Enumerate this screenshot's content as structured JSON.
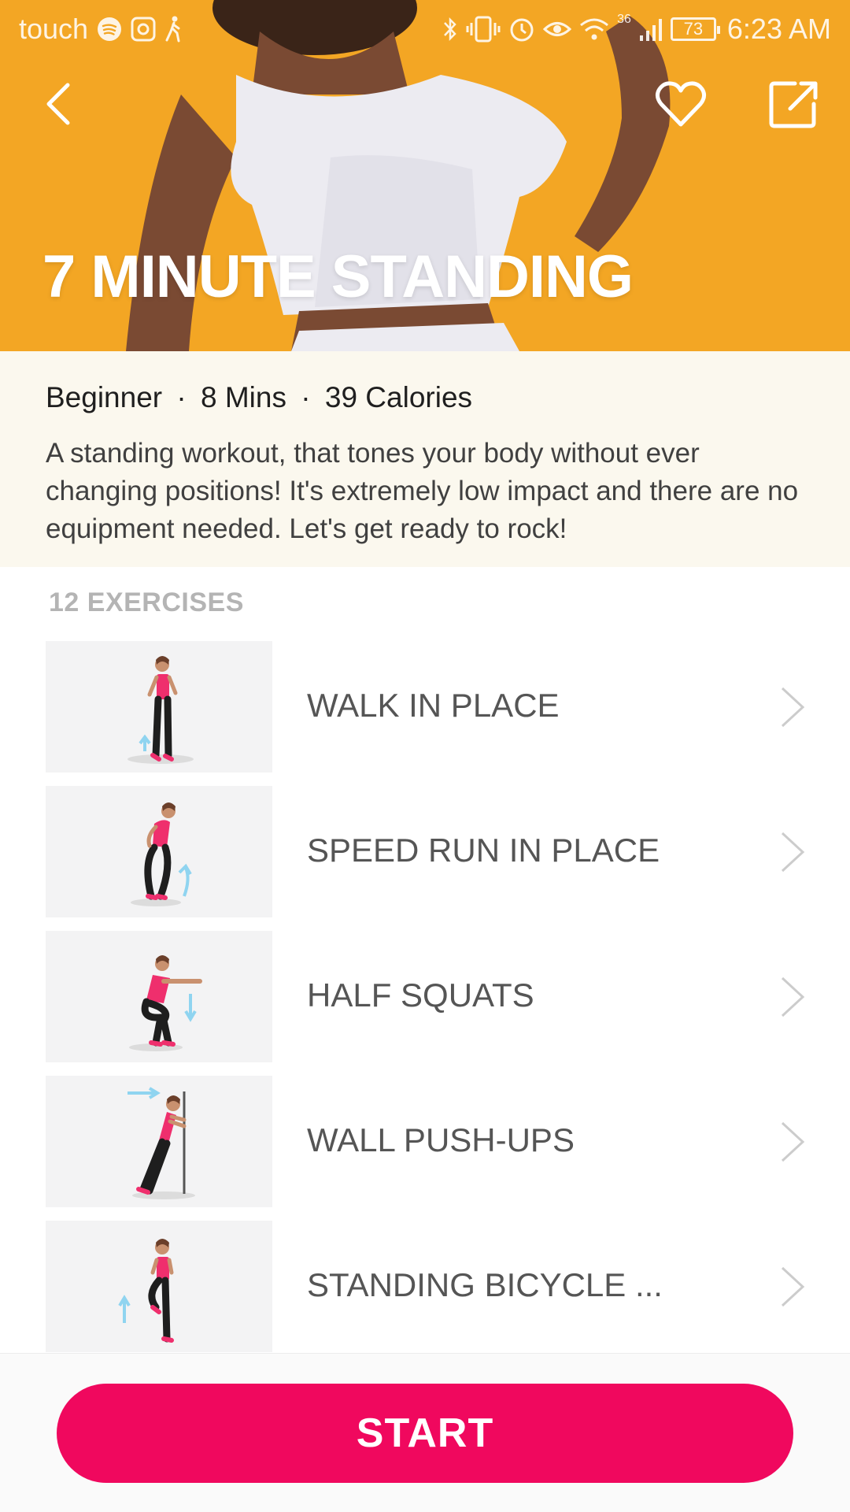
{
  "status_bar": {
    "carrier": "touch",
    "left_icons": [
      "spotify-icon",
      "instagram-icon",
      "walking-icon"
    ],
    "right_icons": [
      "bluetooth-icon",
      "vibrate-icon",
      "alarm-icon",
      "eye-icon",
      "wifi-icon",
      "signal-icon"
    ],
    "network": "36",
    "battery": "73",
    "time": "6:23 AM"
  },
  "hero": {
    "title": "7 MINUTE STANDING",
    "background_color": "#F3A624"
  },
  "info": {
    "level": "Beginner",
    "duration": "8 Mins",
    "calories": "39 Calories",
    "separator": "·",
    "description": "A standing workout, that tones your body without ever changing positions! It's extremely low impact and there are no equipment needed. Let's get ready to rock!"
  },
  "exercises": {
    "header": "12 EXERCISES",
    "items": [
      {
        "name": "WALK IN PLACE",
        "icon": "walk-in-place-illustration"
      },
      {
        "name": "SPEED RUN IN PLACE",
        "icon": "speed-run-illustration"
      },
      {
        "name": "HALF SQUATS",
        "icon": "half-squat-illustration"
      },
      {
        "name": "WALL PUSH-UPS",
        "icon": "wall-pushup-illustration"
      },
      {
        "name": "STANDING BICYCLE ...",
        "icon": "standing-bicycle-illustration"
      }
    ]
  },
  "actions": {
    "start_label": "START",
    "start_color": "#F0085E"
  }
}
